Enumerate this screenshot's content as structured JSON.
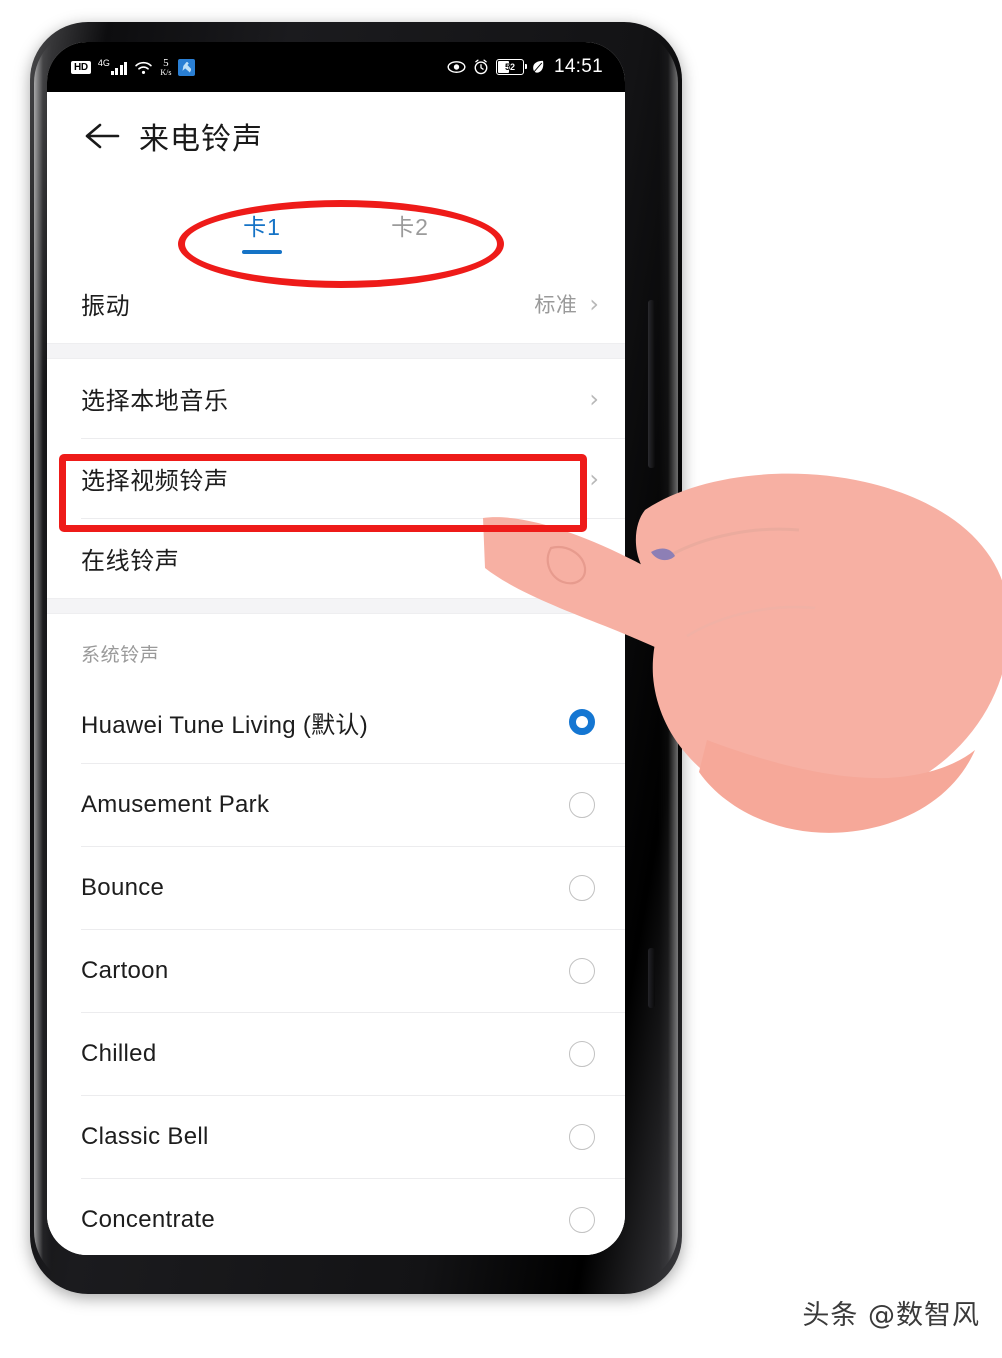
{
  "status_bar": {
    "hd_label": "HD",
    "network_type": "4G",
    "data_rate_value": "5",
    "data_rate_unit": "K/s",
    "app_icon": "running-person-icon",
    "wifi_icon": "wifi-icon",
    "eye_icon": "eye-comfort-icon",
    "alarm_icon": "alarm-clock-icon",
    "battery_percent": "52",
    "eco_icon": "leaf-power-saving-icon",
    "time": "14:51"
  },
  "header": {
    "back_icon": "back-arrow-icon",
    "title": "来电铃声"
  },
  "tabs": [
    {
      "label": "卡1",
      "active": true
    },
    {
      "label": "卡2",
      "active": false
    }
  ],
  "settings": [
    {
      "label": "振动",
      "value": "标准",
      "chevron": "›"
    },
    {
      "label": "选择本地音乐",
      "value": "",
      "chevron": "›"
    },
    {
      "label": "选择视频铃声",
      "value": "",
      "chevron": "›"
    },
    {
      "label": "在线铃声",
      "value": "",
      "chevron": "›"
    }
  ],
  "system_ringtones": {
    "header": "系统铃声",
    "items": [
      {
        "name": "Huawei Tune Living (默认)",
        "selected": true
      },
      {
        "name": "Amusement Park",
        "selected": false
      },
      {
        "name": "Bounce",
        "selected": false
      },
      {
        "name": "Cartoon",
        "selected": false
      },
      {
        "name": "Chilled",
        "selected": false
      },
      {
        "name": "Classic Bell",
        "selected": false
      },
      {
        "name": "Concentrate",
        "selected": false
      }
    ]
  },
  "annotations": {
    "ellipse_target": "卡1 / 卡2 tabs",
    "rect_target": "选择视频铃声",
    "color": "#ee1b19",
    "hand": "pointing-hand-illustration"
  },
  "colors": {
    "accent_blue": "#1573c6",
    "radio_blue": "#1476d2",
    "annotation_red": "#ee1b19",
    "hand_skin": "#f7b0a3"
  },
  "watermark": "头条 @数智风"
}
